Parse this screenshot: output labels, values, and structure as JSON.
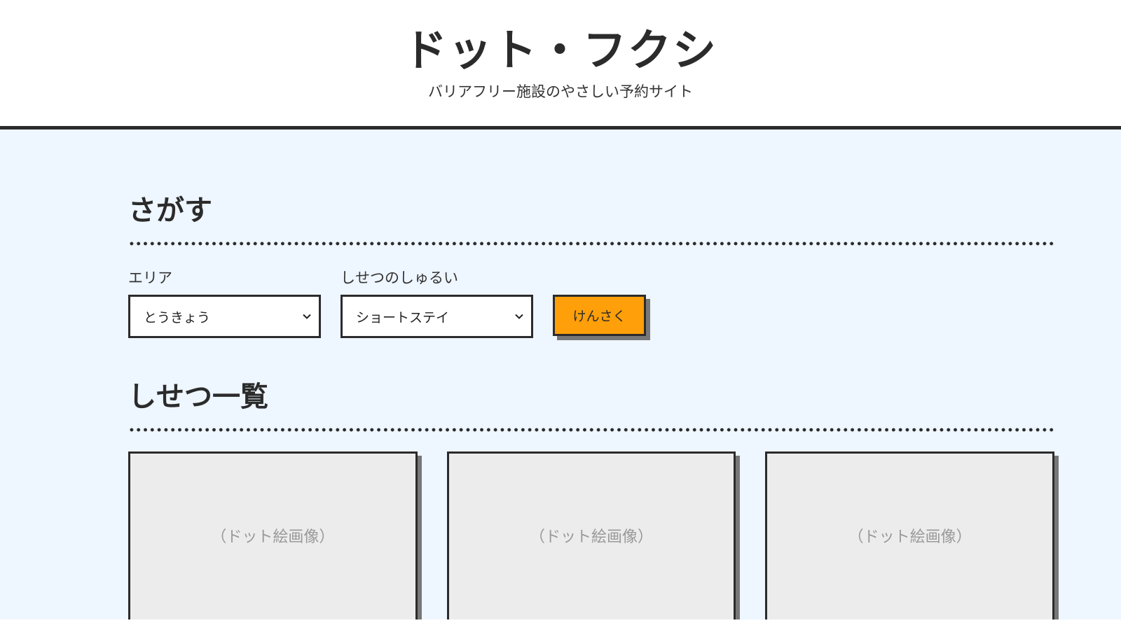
{
  "header": {
    "title": "ドット・フクシ",
    "subtitle": "バリアフリー施設のやさしい予約サイト"
  },
  "search": {
    "heading": "さがす",
    "area_label": "エリア",
    "area_value": "とうきょう",
    "type_label": "しせつのしゅるい",
    "type_value": "ショートステイ",
    "button_label": "けんさく"
  },
  "facilities": {
    "heading": "しせつ一覧",
    "cards": [
      {
        "image_placeholder": "（ドット絵画像）"
      },
      {
        "image_placeholder": "（ドット絵画像）"
      },
      {
        "image_placeholder": "（ドット絵画像）"
      }
    ]
  },
  "colors": {
    "accent_button": "#ff9f0a",
    "page_background": "#eef6ff",
    "card_background": "#ececec",
    "border": "#2b2b2b"
  }
}
